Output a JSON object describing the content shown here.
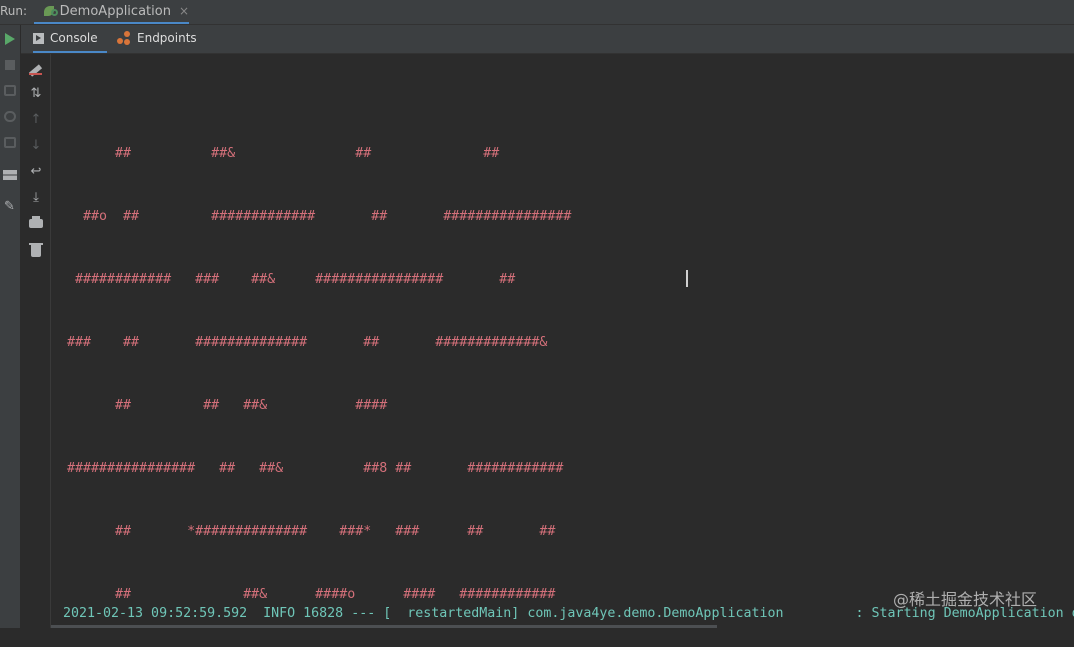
{
  "run_bar": {
    "label": "Run:",
    "tab_title": "DemoApplication",
    "tab_close": "×"
  },
  "tool_tabs": {
    "console": "Console",
    "endpoints": "Endpoints"
  },
  "banner": [
    "        ##          ##&               ##              ##",
    "    ##o  ##         #############       ##       ################",
    "   ############   ###    ##&     ################       ##",
    "  ###    ##       ##############       ##       #############&",
    "        ##         ##   ##&           ####",
    "  ################   ##   ##&          ##8 ##       ############",
    "        ##       *##############    ###*   ###      ##       ##",
    "        ##              ##&      ####o      ####   ############"
  ],
  "log_line": "2021-02-13 09:52:59.592  INFO 16828 --- [  restartedMain] com.java4ye.demo.DemoApplication         : Starting DemoApplication o",
  "watermark": "@稀土掘金技术社区",
  "colors": {
    "banner": "#d4707a",
    "log": "#6fc6b8",
    "accent": "#4a88c7",
    "run_green": "#59a869"
  },
  "icons": {
    "left_strip": [
      "play-icon",
      "stop-icon",
      "camera-icon",
      "bug-icon",
      "exit-icon",
      "layout-icon",
      "pin-icon"
    ],
    "console_tools": [
      "clear-icon",
      "sort-icon",
      "up-arrow-icon",
      "down-arrow-icon",
      "soft-wrap-icon",
      "scroll-to-end-icon",
      "print-icon",
      "trash-icon"
    ]
  }
}
